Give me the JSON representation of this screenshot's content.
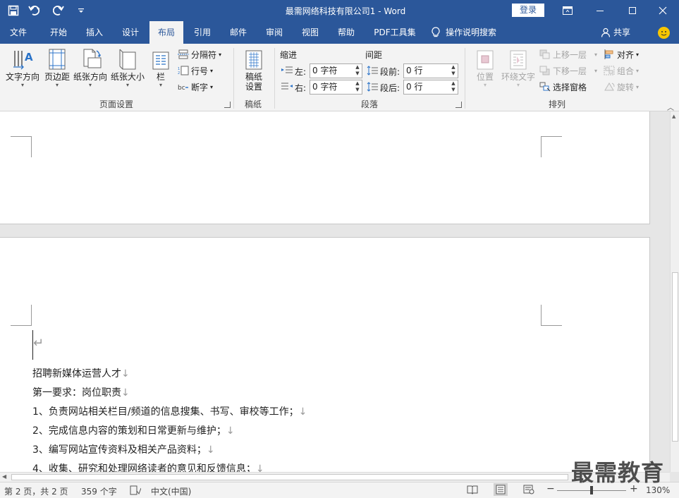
{
  "window": {
    "title": "最需网络科技有限公司1  -  Word",
    "login": "登录"
  },
  "tabs": [
    "文件",
    "开始",
    "插入",
    "设计",
    "布局",
    "引用",
    "邮件",
    "审阅",
    "视图",
    "帮助",
    "PDF工具集"
  ],
  "active_tab": "布局",
  "tell_me": "操作说明搜索",
  "share": "共享",
  "ribbon": {
    "page_setup": {
      "label": "页面设置",
      "text_direction": "文字方向",
      "margins": "页边距",
      "orientation": "纸张方向",
      "size": "纸张大小",
      "columns": "栏",
      "breaks": "分隔符",
      "line_numbers": "行号",
      "hyphenation": "断字"
    },
    "draft_paper": {
      "label": "稿纸",
      "button_line1": "稿纸",
      "button_line2": "设置"
    },
    "paragraph": {
      "label": "段落",
      "indent_title": "缩进",
      "spacing_title": "间距",
      "left_label": "左:",
      "left_value": "0 字符",
      "right_label": "右:",
      "right_value": "0 字符",
      "before_label": "段前:",
      "before_value": "0 行",
      "after_label": "段后:",
      "after_value": "0 行"
    },
    "arrange": {
      "label": "排列",
      "position": "位置",
      "wrap_text": "环绕文字",
      "bring_forward": "上移一层",
      "send_backward": "下移一层",
      "selection_pane": "选择窗格",
      "align": "对齐",
      "group": "组合",
      "rotate": "旋转"
    }
  },
  "document": {
    "lines": [
      "招聘新媒体运营人才",
      "第一要求：岗位职责",
      "1、负责网站相关栏目/频道的信息搜集、书写、审校等工作；",
      "2、完成信息内容的策划和日常更新与维护；",
      "3、编写网站宣传资料及相关产品资料；",
      "4、收集、研究和处理网络读者的意见和反馈信息；"
    ],
    "paragraph_mark": "↓",
    "return_mark": "↵"
  },
  "status": {
    "page": "第 2 页，共 2 页",
    "words": "359 个字",
    "language": "中文(中国)",
    "zoom": "130%",
    "zoom_level": 0.5
  },
  "watermark": "最需教育",
  "colors": {
    "brand": "#2b579a",
    "ribbon_bg": "#f3f3f3",
    "canvas_bg": "#e6e6e6"
  }
}
